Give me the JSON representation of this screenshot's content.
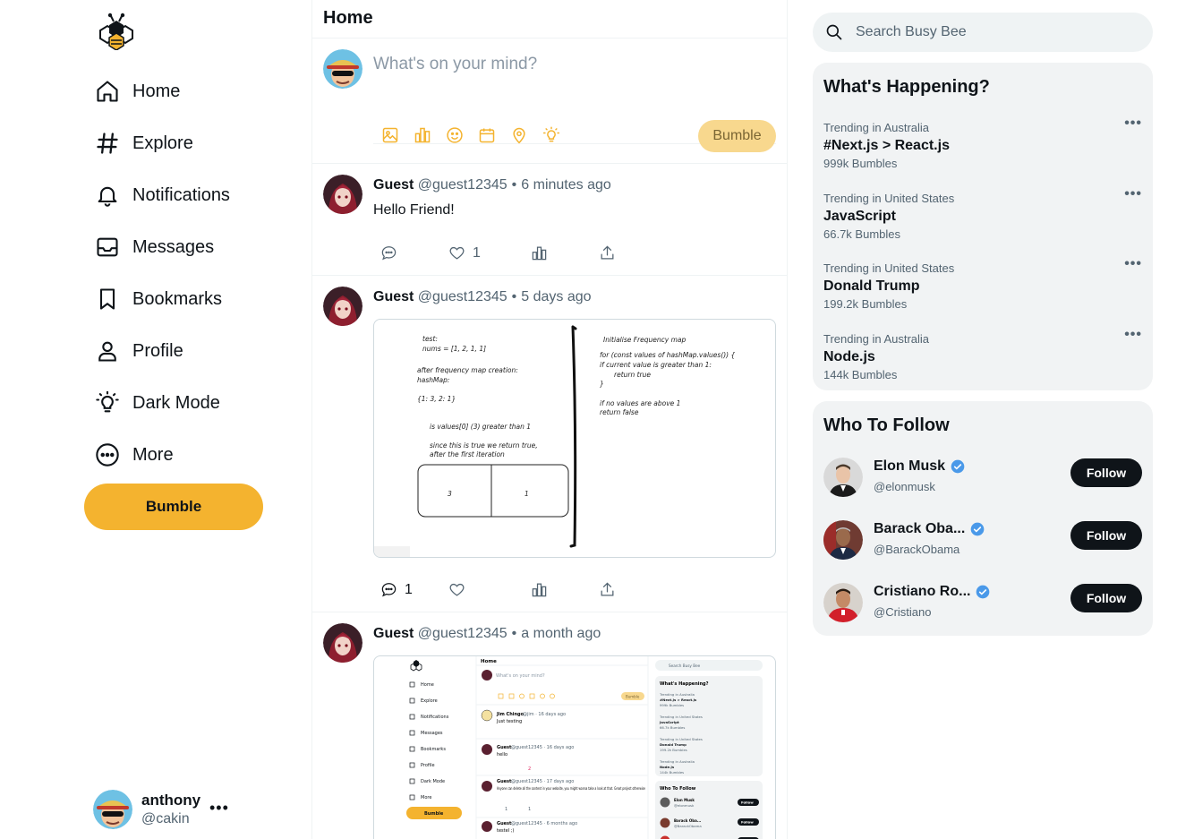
{
  "brand": {
    "accent": "#f4b32f",
    "accent_light": "#f8d88e",
    "logo": "bee-logo-icon"
  },
  "nav": {
    "items": [
      {
        "label": "Home",
        "icon": "home-icon"
      },
      {
        "label": "Explore",
        "icon": "hashtag-icon"
      },
      {
        "label": "Notifications",
        "icon": "bell-icon"
      },
      {
        "label": "Messages",
        "icon": "inbox-icon"
      },
      {
        "label": "Bookmarks",
        "icon": "bookmark-icon"
      },
      {
        "label": "Profile",
        "icon": "user-icon"
      },
      {
        "label": "Dark Mode",
        "icon": "lightbulb-icon"
      },
      {
        "label": "More",
        "icon": "more-circle-icon"
      }
    ],
    "bumble_button": "Bumble"
  },
  "account": {
    "name": "anthony",
    "handle": "@cakin",
    "more": "•••"
  },
  "feed": {
    "title": "Home",
    "composer": {
      "placeholder": "What's on your mind?",
      "submit_label": "Bumble"
    },
    "posts": [
      {
        "name": "Guest",
        "handle": "@guest12345",
        "time": "6 minutes ago",
        "text": "Hello Friend!",
        "replies": "",
        "likes": "1"
      },
      {
        "name": "Guest",
        "handle": "@guest12345",
        "time": "5 days ago",
        "text": "",
        "replies": "1",
        "likes": "",
        "media": {
          "left_lines": [
            "test:",
            "nums = [1, 2, 1, 1]",
            "after frequency map creation:",
            "hashMap:",
            "{1: 3, 2: 1}",
            "is values[0] (3) greater than 1",
            "since this is true we return true,",
            "after the first iteration",
            "3",
            "1"
          ],
          "right_lines": [
            "Initialise Frequency map",
            "for (const values of hashMap.values()) {",
            "if current value is greater than 1:",
            "return true",
            "}",
            "if no values are above 1",
            "return false"
          ]
        }
      },
      {
        "name": "Guest",
        "handle": "@guest12345",
        "time": "a month ago",
        "text": "",
        "replies": "",
        "likes": "",
        "media": {
          "home": "Home",
          "nav": [
            "Home",
            "Explore",
            "Notifications",
            "Messages",
            "Bookmarks",
            "Profile",
            "Dark Mode",
            "More"
          ],
          "bumble": "Bumble",
          "placeholder": "What's on your mind?",
          "posts": [
            {
              "name": "Jim Chingo",
              "meta": "@jim · 16 days ago",
              "text": "Just testing"
            },
            {
              "name": "Guest",
              "meta": "@guest12345 · 16 days ago",
              "text": "hello",
              "likes": "2"
            },
            {
              "name": "Guest",
              "meta": "@guest12345 · 17 days ago",
              "text": "Anyone can delete all the content in your website, you might wanna take a look at that. Great project otherwise",
              "likes": "1",
              "replies": "1"
            },
            {
              "name": "Guest",
              "meta": "@guest12345 · 6 months ago",
              "text": "testel ;)"
            }
          ],
          "search": "Search Busy Bee",
          "happening": "What's Happening?",
          "trends": [
            {
              "loc": "Trending in Australia",
              "tag": "#Next.js > React.js",
              "count": "999k Bumbles"
            },
            {
              "loc": "Trending in United States",
              "tag": "JavaScript",
              "count": "66.7k Bumbles"
            },
            {
              "loc": "Trending in United States",
              "tag": "Donald Trump",
              "count": "199.2k Bumbles"
            },
            {
              "loc": "Trending in Australia",
              "tag": "Node.js",
              "count": "144k Bumbles"
            }
          ],
          "who": "Who To Follow",
          "follows": [
            {
              "name": "Elon Musk",
              "handle": "@elonmusk"
            },
            {
              "name": "Barack Oba...",
              "handle": "@BarackObama"
            }
          ],
          "follow": "Follow"
        }
      }
    ]
  },
  "search": {
    "placeholder": "Search Busy Bee",
    "icon": "search-icon"
  },
  "trending": {
    "title": "What's Happening?",
    "items": [
      {
        "location": "Trending in Australia",
        "tag": "#Next.js > React.js",
        "count": "999k Bumbles"
      },
      {
        "location": "Trending in United States",
        "tag": "JavaScript",
        "count": "66.7k Bumbles"
      },
      {
        "location": "Trending in United States",
        "tag": "Donald Trump",
        "count": "199.2k Bumbles"
      },
      {
        "location": "Trending in Australia",
        "tag": "Node.js",
        "count": "144k Bumbles"
      }
    ],
    "more": "•••"
  },
  "who_to_follow": {
    "title": "Who To Follow",
    "users": [
      {
        "name": "Elon Musk",
        "handle": "@elonmusk",
        "verified": true
      },
      {
        "name": "Barack Oba...",
        "handle": "@BarackObama",
        "verified": true
      },
      {
        "name": "Cristiano Ro...",
        "handle": "@Cristiano",
        "verified": true
      }
    ],
    "follow_label": "Follow"
  }
}
